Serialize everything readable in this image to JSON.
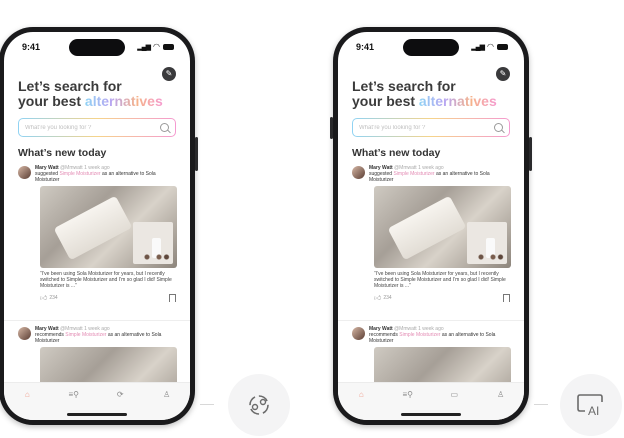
{
  "status": {
    "time": "9:41"
  },
  "app": {
    "headline_line1": "Let’s search for",
    "headline_line2_prefix": "your best ",
    "headline_line2_accent": "alternatives",
    "search_placeholder": "What’re you looking for ?",
    "section_title": "What’s new today"
  },
  "posts": [
    {
      "user": "Mary Watt",
      "handle": "@Mmwatt",
      "time": "1 week ago",
      "action_left": "suggested",
      "action_right": "recommends",
      "product": "Simple Moisturizer",
      "connector": "as an alternative to",
      "target": "Sola Moisturizer",
      "quote": "“I’ve been using Sola Moisturizer for years, but I recently switched to Simple Moisturizer and I’m so glad I did! Simple Moisturizer is ...”",
      "likes": "234"
    }
  ],
  "tabs_left": [
    "home",
    "search-list",
    "swap",
    "profile"
  ],
  "tabs_right": [
    "home",
    "search-list",
    "ai-chat",
    "profile"
  ],
  "float_icons": {
    "left": "swap-icon",
    "right": "ai-chat-icon",
    "right_label": "AI"
  },
  "colors": {
    "accent_pink": "#e38cb4",
    "tab_active": "#f0a090"
  }
}
